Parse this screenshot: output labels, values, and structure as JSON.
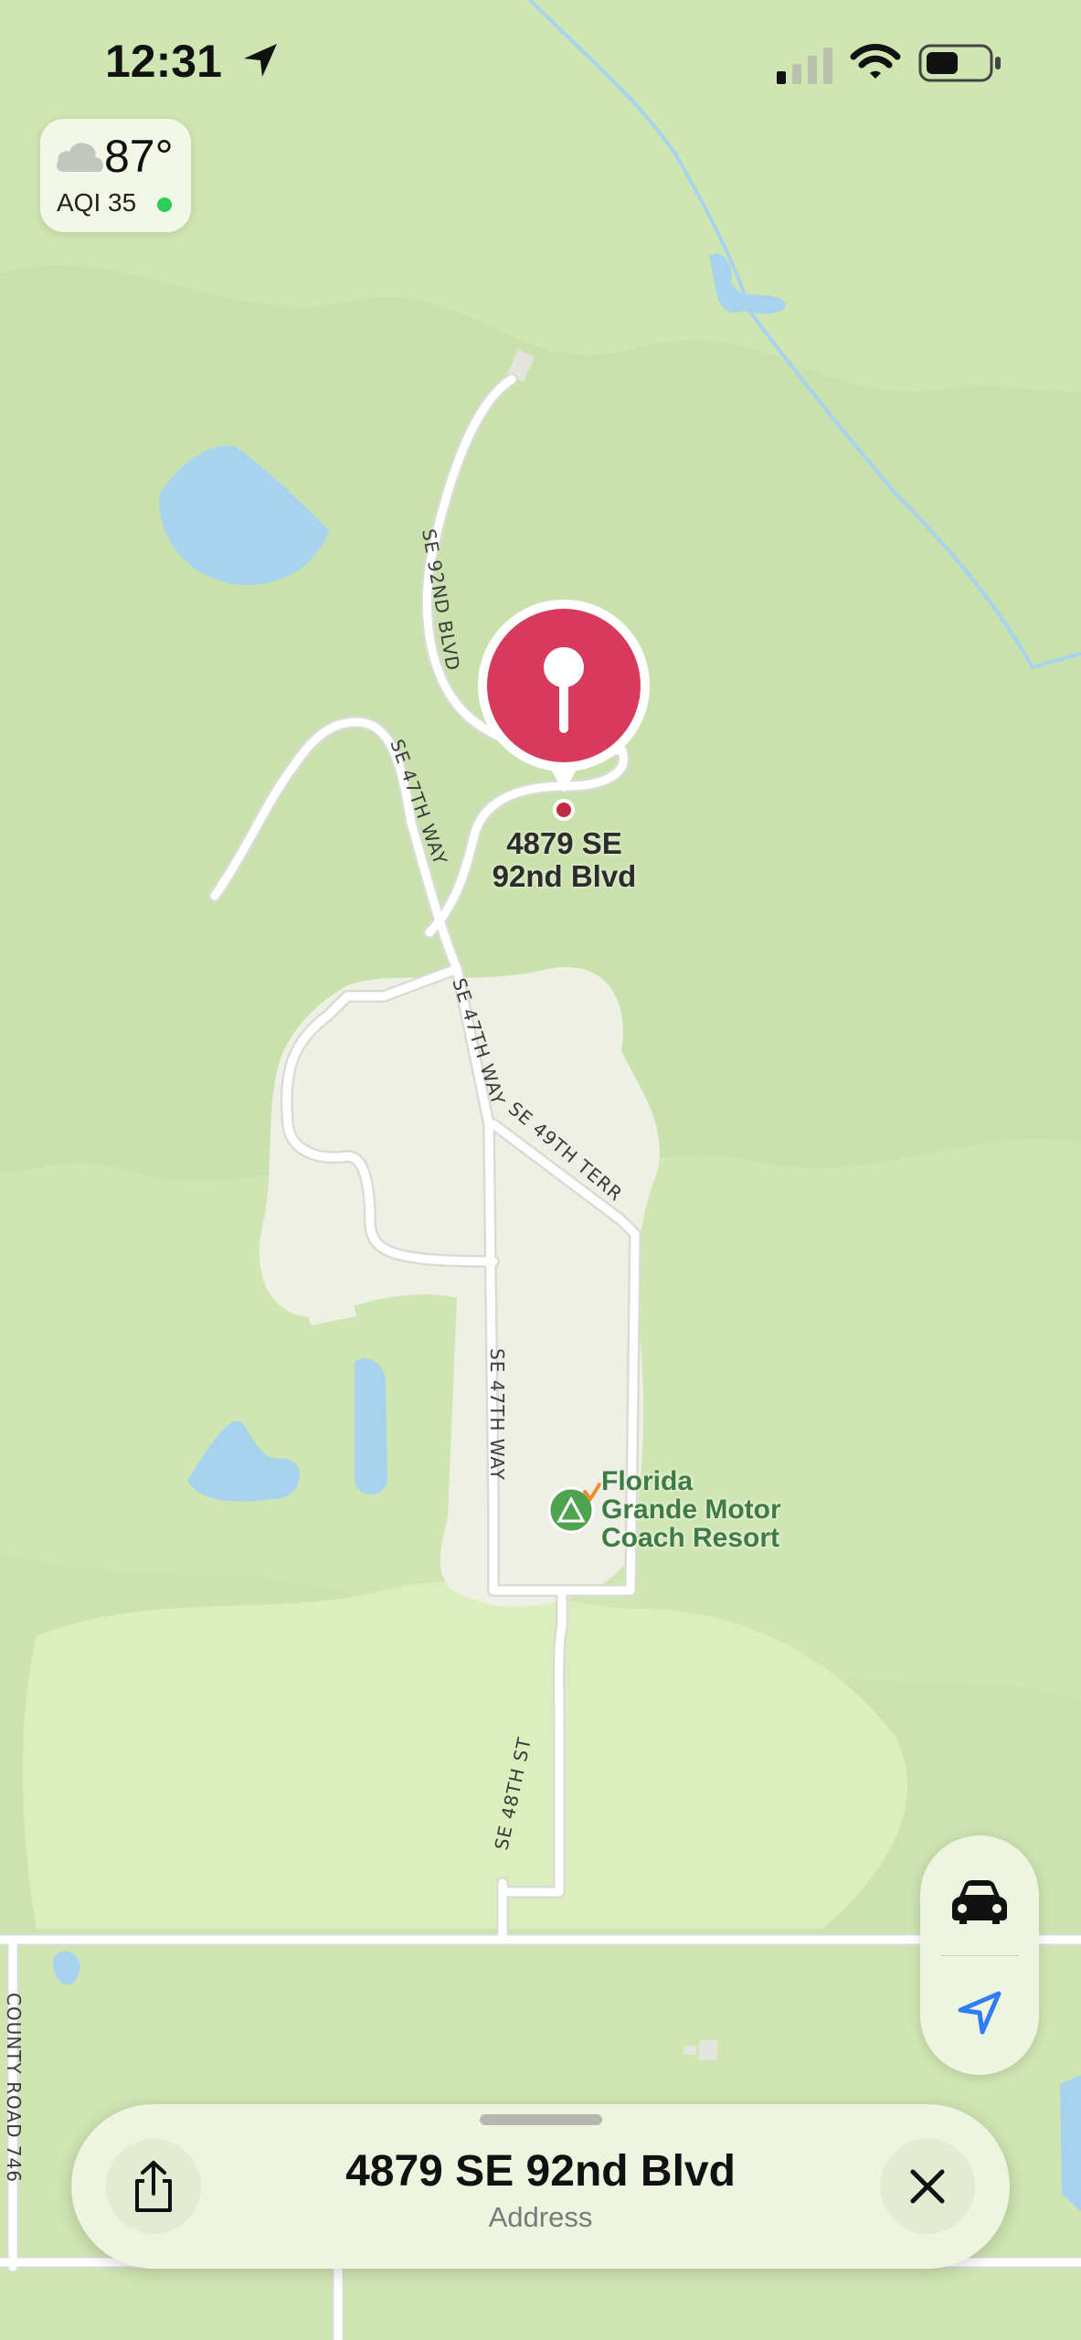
{
  "status_bar": {
    "time": "12:31"
  },
  "weather": {
    "temperature": "87°",
    "aqi": "AQI 35",
    "aqi_color": "#2ecc5a"
  },
  "map": {
    "roads": {
      "se_92nd_blvd": "SE 92ND BLVD",
      "se_47th_way_north": "SE 47TH WAY",
      "se_47th_way_mid": "SE 47TH WAY",
      "se_47th_way_south": "SE 47TH WAY",
      "se_49th_terr": "SE 49TH TERR",
      "se_48th_st": "SE 48TH ST",
      "county_road_746": "COUNTY ROAD 746"
    },
    "pin": {
      "label_line1": "4879 SE",
      "label_line2": "92nd Blvd",
      "color": "#d83a5c"
    },
    "poi": {
      "line1": "Florida",
      "line2": "Grande Motor",
      "line3": "Coach Resort",
      "color": "#3f7b45"
    }
  },
  "controls": {
    "drive_icon": "car-icon",
    "locate_icon": "location-arrow-icon",
    "accent": "#2f7cf6"
  },
  "place_card": {
    "title": "4879 SE 92nd Blvd",
    "subtitle": "Address",
    "share_icon": "share-icon",
    "close_icon": "close-icon"
  }
}
